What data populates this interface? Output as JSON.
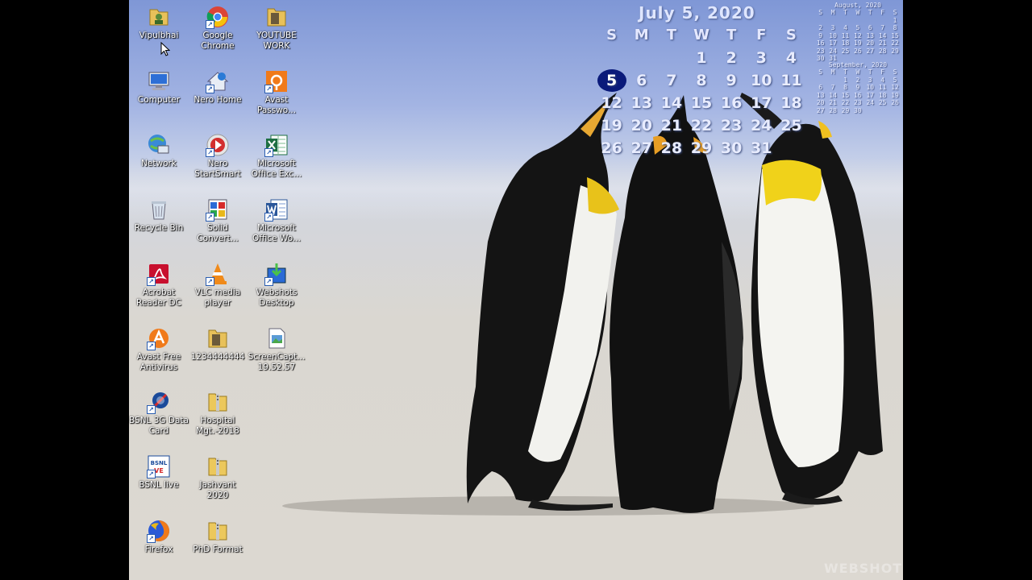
{
  "icons": [
    {
      "label": "Vipulbhai",
      "icon": "user-folder-icon",
      "col": 0,
      "row": 0
    },
    {
      "label": "Google Chrome",
      "icon": "chrome-icon",
      "col": 1,
      "row": 0
    },
    {
      "label": "YOUTUBE WORK",
      "icon": "folder-icon",
      "col": 2,
      "row": 0
    },
    {
      "label": "Computer",
      "icon": "computer-icon",
      "col": 0,
      "row": 1
    },
    {
      "label": "Nero Home",
      "icon": "nero-home-icon",
      "col": 1,
      "row": 1
    },
    {
      "label": "Avast Passwo...",
      "icon": "avast-passwords-icon",
      "col": 2,
      "row": 1
    },
    {
      "label": "Network",
      "icon": "network-icon",
      "col": 0,
      "row": 2
    },
    {
      "label": "Nero StartSmart",
      "icon": "nero-startsmart-icon",
      "col": 1,
      "row": 2
    },
    {
      "label": "Microsoft Office Exc...",
      "icon": "excel-icon",
      "col": 2,
      "row": 2
    },
    {
      "label": "Recycle Bin",
      "icon": "recycle-bin-icon",
      "col": 0,
      "row": 3
    },
    {
      "label": "Solid Convert...",
      "icon": "solid-converter-icon",
      "col": 1,
      "row": 3
    },
    {
      "label": "Microsoft Office Wo...",
      "icon": "word-icon",
      "col": 2,
      "row": 3
    },
    {
      "label": "Acrobat Reader DC",
      "icon": "acrobat-icon",
      "col": 0,
      "row": 4
    },
    {
      "label": "VLC media player",
      "icon": "vlc-icon",
      "col": 1,
      "row": 4
    },
    {
      "label": "Webshots Desktop",
      "icon": "webshots-icon",
      "col": 2,
      "row": 4
    },
    {
      "label": "Avast Free Antivirus",
      "icon": "avast-antivirus-icon",
      "col": 0,
      "row": 5
    },
    {
      "label": "1234444444",
      "icon": "folder-icon",
      "col": 1,
      "row": 5
    },
    {
      "label": "ScreenCapt... 19.52.57",
      "icon": "image-file-icon",
      "col": 2,
      "row": 5
    },
    {
      "label": "BSNL 3G Data Card",
      "icon": "bsnl-datacard-icon",
      "col": 0,
      "row": 6
    },
    {
      "label": "Hospital Mgt.-2018",
      "icon": "zip-folder-icon",
      "col": 1,
      "row": 6
    },
    {
      "label": "BSNL live",
      "icon": "bsnl-live-icon",
      "col": 0,
      "row": 7
    },
    {
      "label": "Jashvant 2020",
      "icon": "zip-folder-icon",
      "col": 1,
      "row": 7
    },
    {
      "label": "Firefox",
      "icon": "firefox-icon",
      "col": 0,
      "row": 8
    },
    {
      "label": "PhD Format",
      "icon": "zip-folder-icon",
      "col": 1,
      "row": 8
    }
  ],
  "calendar": {
    "title": "July 5, 2020",
    "weekdays": [
      "S",
      "M",
      "T",
      "W",
      "T",
      "F",
      "S"
    ],
    "weeks": [
      [
        "",
        "",
        "",
        "1",
        "2",
        "3",
        "4"
      ],
      [
        "5",
        "6",
        "7",
        "8",
        "9",
        "10",
        "11"
      ],
      [
        "12",
        "13",
        "14",
        "15",
        "16",
        "17",
        "18"
      ],
      [
        "19",
        "20",
        "21",
        "22",
        "23",
        "24",
        "25"
      ],
      [
        "26",
        "27",
        "28",
        "29",
        "30",
        "31",
        ""
      ]
    ],
    "today": "5"
  },
  "mini_calendars": [
    {
      "title": "August, 2020",
      "weekdays": [
        "S",
        "M",
        "T",
        "W",
        "T",
        "F",
        "S"
      ],
      "weeks": [
        [
          "",
          "",
          "",
          "",
          "",
          "",
          "1"
        ],
        [
          "2",
          "3",
          "4",
          "5",
          "6",
          "7",
          "8"
        ],
        [
          "9",
          "10",
          "11",
          "12",
          "13",
          "14",
          "15"
        ],
        [
          "16",
          "17",
          "18",
          "19",
          "20",
          "21",
          "22"
        ],
        [
          "23",
          "24",
          "25",
          "26",
          "27",
          "28",
          "29"
        ],
        [
          "30",
          "31",
          "",
          "",
          "",
          "",
          ""
        ]
      ]
    },
    {
      "title": "September, 2020",
      "weekdays": [
        "S",
        "M",
        "T",
        "W",
        "T",
        "F",
        "S"
      ],
      "weeks": [
        [
          "",
          "",
          "1",
          "2",
          "3",
          "4",
          "5"
        ],
        [
          "6",
          "7",
          "8",
          "9",
          "10",
          "11",
          "12"
        ],
        [
          "13",
          "14",
          "15",
          "16",
          "17",
          "18",
          "19"
        ],
        [
          "20",
          "21",
          "22",
          "23",
          "24",
          "25",
          "26"
        ],
        [
          "27",
          "28",
          "29",
          "30",
          "",
          "",
          ""
        ]
      ]
    }
  ],
  "watermark": "WEBSHOTS"
}
